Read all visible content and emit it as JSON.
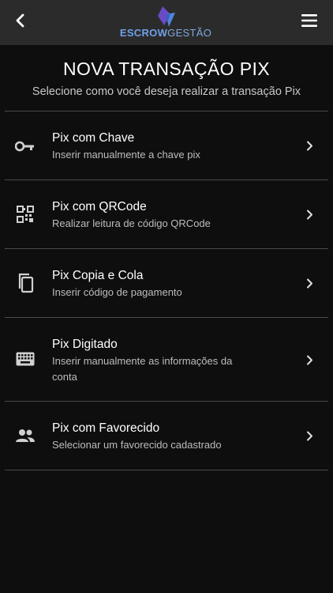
{
  "header": {
    "logo_text_bold": "ESCROW",
    "logo_text_light": "GESTÃO",
    "back_icon": "chevron-left-icon",
    "menu_icon": "hamburger-menu-icon"
  },
  "page": {
    "title": "NOVA TRANSAÇÃO PIX",
    "subtitle": "Selecione como você deseja realizar a transação Pix"
  },
  "options": [
    {
      "title": "Pix com Chave",
      "description": "Inserir manualmente a chave pix",
      "icon": "key-icon"
    },
    {
      "title": "Pix com QRCode",
      "description": "Realizar leitura de código QRCode",
      "icon": "qr-code-icon"
    },
    {
      "title": "Pix Copia e Cola",
      "description": "Inserir código de pagamento",
      "icon": "copy-icon"
    },
    {
      "title": "Pix Digitado",
      "description": "Inserir manualmente as informações da conta",
      "icon": "keyboard-icon"
    },
    {
      "title": "Pix com Favorecido",
      "description": "Selecionar um favorecido cadastrado",
      "icon": "people-icon"
    }
  ],
  "colors": {
    "background": "#0e0e0e",
    "header": "#2b2b2b",
    "divider": "#4a4a4a",
    "logo_blue": "#6fa0e8",
    "logo_purple": "#6a4bc4"
  }
}
